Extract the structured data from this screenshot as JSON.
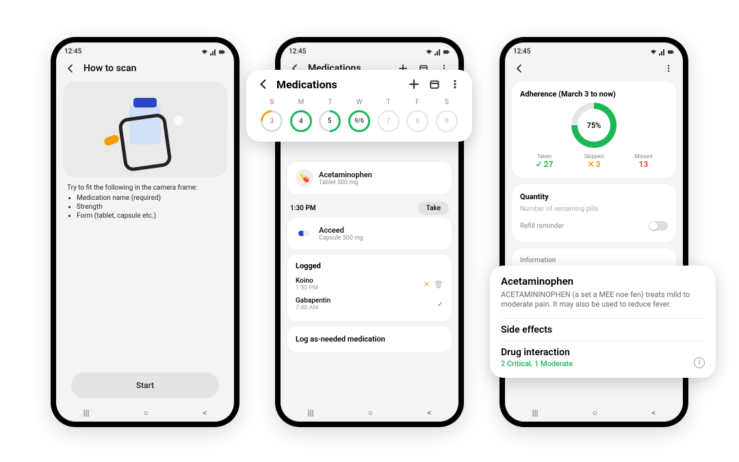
{
  "statusbar": {
    "time": "12:45"
  },
  "phone1": {
    "title": "How to scan",
    "instruct_lead": "Try to fit the following in the camera frame:",
    "instruct_items": [
      "Medication name (required)",
      "Strength",
      "Form (tablet, capsule etc.)"
    ],
    "start": "Start"
  },
  "phone2": {
    "title": "Medications",
    "items_partial": {
      "name": "Acetaminophen",
      "sub": "Tablet 500 mg"
    },
    "slot_time": "1:30 PM",
    "take": "Take",
    "med2": {
      "name": "Acceed",
      "sub": "Capsule 500 mg"
    },
    "logged_title": "Logged",
    "log1": {
      "name": "Koino",
      "time": "1:30 PM"
    },
    "log2": {
      "name": "Gabapentin",
      "time": "7:40 AM"
    },
    "logas": "Log as-needed medication"
  },
  "float_week": {
    "title": "Medications",
    "days": [
      {
        "label": "S",
        "value": "3"
      },
      {
        "label": "M",
        "value": "4"
      },
      {
        "label": "T",
        "value": "5"
      },
      {
        "label": "W",
        "value": "9/6"
      },
      {
        "label": "T",
        "value": "7"
      },
      {
        "label": "F",
        "value": "8"
      },
      {
        "label": "S",
        "value": "9"
      }
    ]
  },
  "phone3": {
    "adherence_title": "Adherence (March 3 to now)",
    "adherence_pct": "75%",
    "taken_label": "Taken",
    "taken_val": "27",
    "skipped_label": "Skipped",
    "skipped_val": "3",
    "missed_label": "Missed",
    "missed_val": "13",
    "quantity_title": "Quantity",
    "quantity_placeholder": "Number of remaining pills",
    "refill": "Refill reminder",
    "info_hdr": "Information"
  },
  "float_info": {
    "drug_name": "Acetaminophen",
    "desc": "ACETAMININOPHEN (a set a MEE noe fen) treats mild to moderate pain. It may also be used to reduce fever.",
    "side_effects": "Side effects",
    "interaction": "Drug interaction",
    "interaction_sub": "2 Critical, 1 Moderate"
  }
}
